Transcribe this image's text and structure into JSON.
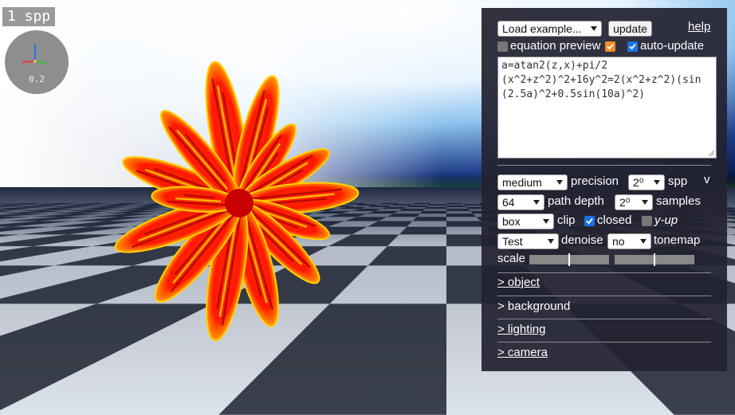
{
  "renderer": {
    "spp_counter": "1 spp",
    "gizmo_scale": "0.2"
  },
  "panel": {
    "load_example": "Load example...",
    "update_button": "update",
    "help_link": "help",
    "equation_preview_label": "equation preview",
    "equation_preview_checked": false,
    "auto_update_checked_orange": true,
    "auto_update_label": "auto-update",
    "auto_update_checked": true,
    "equation": "a=atan2(z,x)+pi/2\n(x^2+z^2)^2+16y^2=2(x^2+z^2)(sin(2.5a)^2+0.5sin(10a)^2)",
    "collapse_toggle": "v",
    "precision_value": "medium",
    "precision_label": "precision",
    "spp_value": "2⁰",
    "spp_label": "spp",
    "path_depth_value": "64",
    "path_depth_label": "path depth",
    "samples_value": "2⁰",
    "samples_label": "samples",
    "clip_value": "box",
    "clip_label": "clip",
    "closed_label": "closed",
    "closed_checked": true,
    "y_up_label": "y-up",
    "y_up_checked": false,
    "denoise_value": "Test",
    "denoise_label": "denoise",
    "tonemap_value": "no",
    "tonemap_label": "tonemap",
    "scale_label": "scale",
    "scale_slider_1": 0.5,
    "scale_slider_2": 0.5,
    "sections": {
      "object": "> object",
      "background": "> background",
      "lighting": "> lighting",
      "camera": "> camera"
    }
  },
  "colors": {
    "panel_bg": "#222230",
    "checkbox_blue": "#1a73e8",
    "checkbox_orange": "#f28c28"
  }
}
